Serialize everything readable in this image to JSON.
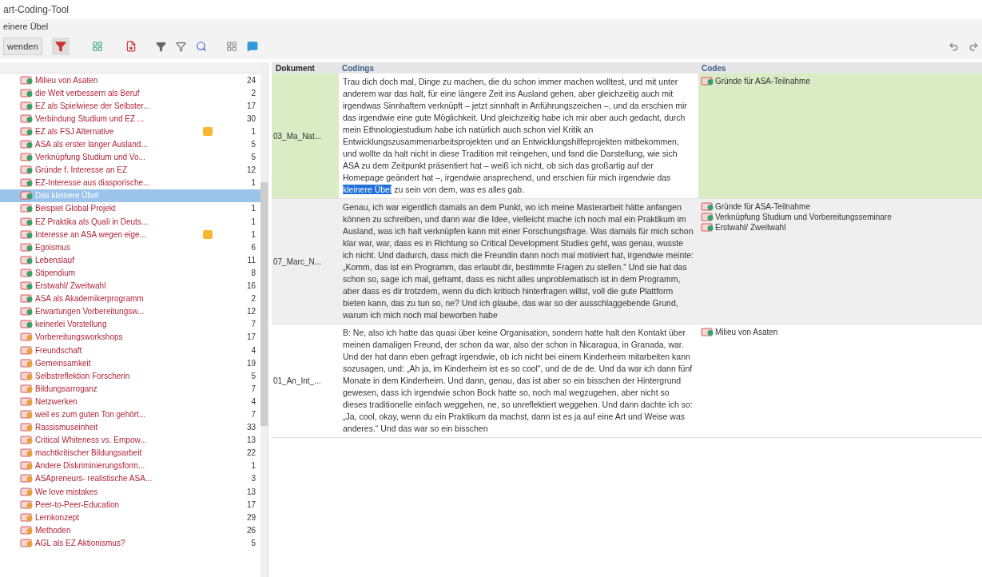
{
  "window": {
    "title": "art-Coding-Tool",
    "subtitle": "einere Übel"
  },
  "toolbar": {
    "button": "wenden"
  },
  "code_list": [
    {
      "label": "Milieu von Asaten",
      "count": "24",
      "color": "#3aa06a",
      "memo": false,
      "selected": false
    },
    {
      "label": "die Welt verbessern als Beruf",
      "count": "2",
      "color": "#3aa06a",
      "memo": false,
      "selected": false
    },
    {
      "label": "EZ als Spielwiese der Selbster...",
      "count": "17",
      "color": "#3aa06a",
      "memo": false,
      "selected": false
    },
    {
      "label": "Verbindung Studium und EZ ...",
      "count": "30",
      "color": "#3aa06a",
      "memo": false,
      "selected": false
    },
    {
      "label": "EZ als FSJ Alternative",
      "count": "1",
      "color": "#3aa06a",
      "memo": true,
      "selected": false
    },
    {
      "label": "ASA als erster langer Ausland...",
      "count": "5",
      "color": "#3aa06a",
      "memo": false,
      "selected": false
    },
    {
      "label": "Verknüpfung Studium und Vo...",
      "count": "5",
      "color": "#3aa06a",
      "memo": false,
      "selected": false
    },
    {
      "label": "Gründe f. Interesse an EZ",
      "count": "12",
      "color": "#3aa06a",
      "memo": false,
      "selected": false
    },
    {
      "label": "EZ-Interesse aus diasporische...",
      "count": "1",
      "color": "#3aa06a",
      "memo": false,
      "selected": false
    },
    {
      "label": "Das kleinere Übel",
      "color": "#3aa06a",
      "memo": false,
      "selected": true
    },
    {
      "label": "Beispiel Global Projekt",
      "count": "1",
      "color": "#3aa06a",
      "memo": false,
      "selected": false
    },
    {
      "label": "EZ Praktika als Quali in Deuts...",
      "count": "1",
      "color": "#3aa06a",
      "memo": false,
      "selected": false
    },
    {
      "label": "Interesse an ASA wegen eige...",
      "count": "1",
      "color": "#3aa06a",
      "memo": true,
      "selected": false
    },
    {
      "label": "Egoismus",
      "count": "6",
      "color": "#3aa06a",
      "memo": false,
      "selected": false
    },
    {
      "label": "Lebenslauf",
      "count": "11",
      "color": "#3aa06a",
      "memo": false,
      "selected": false
    },
    {
      "label": "Stipendium",
      "count": "8",
      "color": "#3aa06a",
      "memo": false,
      "selected": false
    },
    {
      "label": "Erstwahl/ Zweitwahl",
      "count": "16",
      "color": "#3aa06a",
      "memo": false,
      "selected": false
    },
    {
      "label": "ASA als Akademikerprogramm",
      "count": "2",
      "color": "#3aa06a",
      "memo": false,
      "selected": false
    },
    {
      "label": "Erwartungen Vorbereitungsw...",
      "count": "12",
      "color": "#3aa06a",
      "memo": false,
      "selected": false
    },
    {
      "label": "keinerlei Vorstellung",
      "count": "7",
      "color": "#3aa06a",
      "memo": false,
      "selected": false
    },
    {
      "label": "Vorbereitungsworkshops",
      "count": "17",
      "color": "#e8a13a",
      "memo": false,
      "selected": false
    },
    {
      "label": "Freundschaft",
      "count": "4",
      "color": "#e8a13a",
      "memo": false,
      "selected": false
    },
    {
      "label": "Gemeinsamkeit",
      "count": "19",
      "color": "#e8a13a",
      "memo": false,
      "selected": false
    },
    {
      "label": "Selbstreflektion Forscherin",
      "count": "5",
      "color": "#e8a13a",
      "memo": false,
      "selected": false
    },
    {
      "label": "Bildungsarroganz",
      "count": "7",
      "color": "#e8a13a",
      "memo": false,
      "selected": false
    },
    {
      "label": "Netzwerken",
      "count": "4",
      "color": "#e8a13a",
      "memo": false,
      "selected": false
    },
    {
      "label": "weil es zum guten Ton gehört...",
      "count": "7",
      "color": "#e8a13a",
      "memo": false,
      "selected": false
    },
    {
      "label": "Rassismuseinheit",
      "count": "33",
      "color": "#e8a13a",
      "memo": false,
      "selected": false
    },
    {
      "label": "Critical Whiteness vs. Empow...",
      "count": "13",
      "color": "#e8a13a",
      "memo": false,
      "selected": false
    },
    {
      "label": "machtkritischer Bildungsarbeit",
      "count": "22",
      "color": "#e8a13a",
      "memo": false,
      "selected": false
    },
    {
      "label": "Andere Diskriminierungsform...",
      "count": "1",
      "color": "#e8a13a",
      "memo": false,
      "selected": false
    },
    {
      "label": "ASApreneurs- realistische ASA...",
      "count": "3",
      "color": "#e8a13a",
      "memo": false,
      "selected": false
    },
    {
      "label": "We love mistakes",
      "count": "13",
      "color": "#e8a13a",
      "memo": false,
      "selected": false
    },
    {
      "label": "Peer-to-Peer-Education",
      "count": "17",
      "color": "#e8a13a",
      "memo": false,
      "selected": false
    },
    {
      "label": "Lernkonzept",
      "count": "29",
      "color": "#e8a13a",
      "memo": false,
      "selected": false
    },
    {
      "label": "Methoden",
      "count": "26",
      "color": "#e8a13a",
      "memo": false,
      "selected": false
    },
    {
      "label": "AGL als EZ Aktionismus?",
      "count": "5",
      "color": "#e8a13a",
      "memo": false,
      "selected": false
    }
  ],
  "table": {
    "columns": [
      "Dokument",
      "Codings",
      "Codes"
    ],
    "rows": [
      {
        "document": "03_Ma_Nat...",
        "selected": true,
        "segments": [
          {
            "text": "Trau dich doch mal, Dinge zu machen, die du schon immer machen wolltest, und mit unter anderem war das halt, für eine längere Zeit ins Ausland gehen, aber gleichzeitig auch mit irgendwas Sinnhaftem verknüpft – jetzt sinnhaft in Anführungszeichen –, und da erschien mir das irgendwie eine gute Möglichkeit. Und gleichzeitig habe ich mir aber auch gedacht, durch mein Ethnologiestudium habe ich natürlich auch schon viel Kritik an Entwicklungszusammenarbeitsprojekten und an Entwicklungshilfeprojekten mitbekommen, und wollte da halt nicht in diese Tradition mit reingehen, und fand die Darstellung, wie sich ASA zu dem Zeitpunkt präsentiert hat – weiß ich nicht, ob sich das großartig auf der Homepage geändert hat –, irgendwie ansprechend, und erschien für mich irgendwie das ",
            "highlighted": false
          },
          {
            "text": "kleinere Übel",
            "highlighted": true
          },
          {
            "text": " zu sein von dem, was es alles gab.",
            "highlighted": false
          }
        ],
        "codes": [
          "Gründe für ASA-Teilnahme"
        ]
      },
      {
        "document": "07_Marc_N...",
        "selected": false,
        "segments": [
          {
            "text": "Genau, ich war eigentlich damals an dem Punkt, wo ich meine Masterarbeit hätte anfangen können zu schreiben, und dann war die Idee, vielleicht mache ich noch mal ein Praktikum im Ausland, was ich halt verknüpfen kann mit einer Forschungsfrage. Was damals für mich schon klar war, war, dass es in Richtung so Critical Development Studies geht, was genau, wusste ich nicht. Und dadurch, dass mich die Freundin dann noch mal motiviert hat, irgendwie meinte: „Komm, das ist ein Programm, das erlaubt dir, bestimmte Fragen zu stellen.“ Und sie hat das schon so, sage ich mal, geframt, dass es nicht alles unproblematisch ist in dem Programm, aber dass es dir trotzdem, wenn du dich kritisch hinterfragen willst, voll die gute Plattform bieten kann, das zu tun so, ne? Und ich glaube, das war so der ausschlaggebende Grund, warum ich mich noch mal beworben habe",
            "highlighted": false
          }
        ],
        "codes": [
          "Gründe für ASA-Teilnahme",
          "Verknüpfung Studium und Vorbereitungsseminare",
          "Erstwahl/ Zweitwahl"
        ]
      },
      {
        "document": "01_An_Int_...",
        "selected": false,
        "segments": [
          {
            "text": "B: Ne, also ich hatte das quasi über keine Organisation, sondern hatte halt den Kontakt über meinen damaligen Freund, der schon da war, also der schon in Nicaragua, in Granada, war. Und der hat dann eben gefragt irgendwie, ob ich nicht bei einem Kinderheim mitarbeiten kann sozusagen, und: „Ah ja, im Kinderheim ist es so cool“, und de de de. Und da war ich dann fünf Monate in dem Kinderheim. Und dann, genau, das ist aber so ein bisschen der Hintergrund gewesen, dass ich irgendwie schon Bock hatte so, noch mal wegzugehen, aber nicht so dieses traditionelle einfach weggehen, ne, so unreflektiert weggehen. Und dann dachte ich so: „Ja, cool, okay, wenn du ein Praktikum da machst, dann ist es ja auf eine Art und Weise was anderes.“ Und das war so ein bisschen",
            "highlighted": false
          }
        ],
        "codes": [
          "Milieu von Asaten"
        ]
      }
    ]
  }
}
